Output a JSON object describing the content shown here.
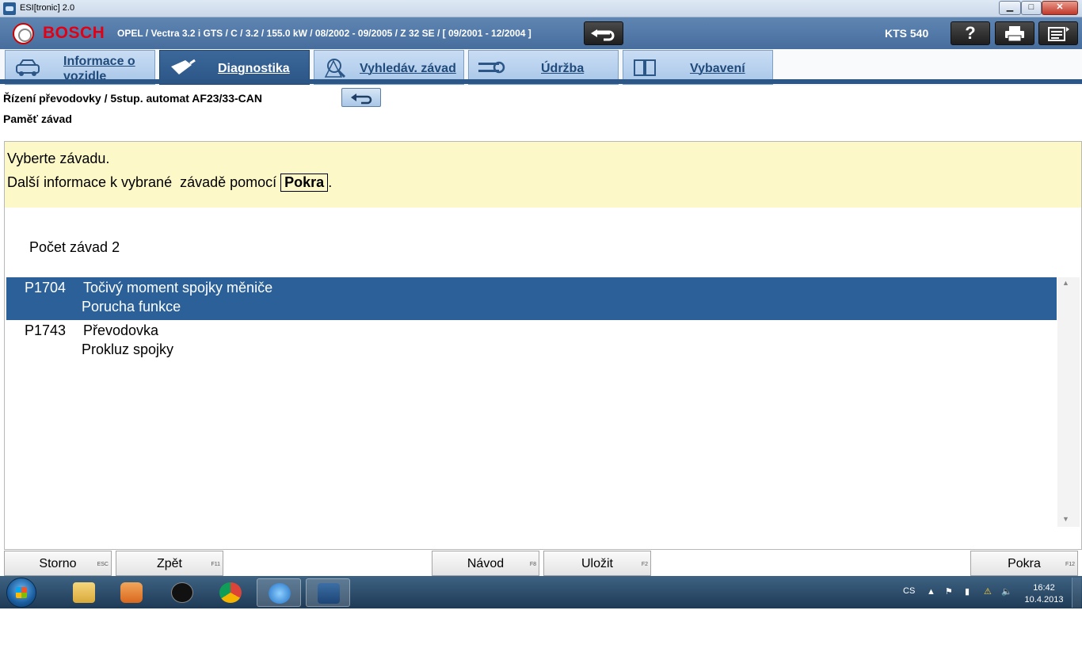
{
  "window": {
    "title": "ESI[tronic] 2.0",
    "min_label": "▁",
    "max_label": "□",
    "close_label": "✕"
  },
  "header": {
    "brand": "BOSCH",
    "vehicle": "OPEL / Vectra 3.2 i GTS / C / 3.2 / 155.0 kW / 08/2002 - 09/2005 / Z 32 SE / [ 09/2001 - 12/2004 ]",
    "device": "KTS 540",
    "help_label": "?"
  },
  "tabs": [
    {
      "label_line1": "Informace o",
      "label_line2": "vozidle",
      "icon": "car-info-icon"
    },
    {
      "label": "Diagnostika",
      "icon": "diagnostic-plug-icon",
      "active": true
    },
    {
      "label": "Vyhledáv. závad",
      "icon": "search-fault-icon"
    },
    {
      "label": "Údržba",
      "icon": "maintenance-icon"
    },
    {
      "label": "Vybavení",
      "icon": "equipment-book-icon"
    }
  ],
  "breadcrumb": {
    "path": "Řízení převodovky / 5stup. automat AF23/33-CAN",
    "section": "Paměť závad"
  },
  "notice": {
    "line1": "Vyberte závadu.",
    "line2_prefix": "Další informace k vybrané  závadě pomocí ",
    "line2_key": "Pokra",
    "line2_suffix": "."
  },
  "fault_count": "Počet závad 2",
  "faults": [
    {
      "code": "P1704",
      "line1": "Točivý moment spojky měniče",
      "line2": "Porucha funkce",
      "selected": true
    },
    {
      "code": "P1743",
      "line1": "Převodovka",
      "line2": "Prokluz spojky",
      "selected": false
    }
  ],
  "buttons": {
    "storno": {
      "label": "Storno",
      "key": "ESC"
    },
    "zpet": {
      "label": "Zpět",
      "key": "F11"
    },
    "navod": {
      "label": "Návod",
      "key": "F8"
    },
    "ulozit": {
      "label": "Uložit",
      "key": "F2"
    },
    "pokra": {
      "label": "Pokra",
      "key": "F12"
    }
  },
  "taskbar": {
    "language": "CS",
    "time": "16:42",
    "date": "10.4.2013"
  },
  "colors": {
    "header_blue": "#466d9c",
    "selected_row": "#2b6198",
    "notice_bg": "#fdf8c8",
    "bosch_red": "#e20015"
  }
}
